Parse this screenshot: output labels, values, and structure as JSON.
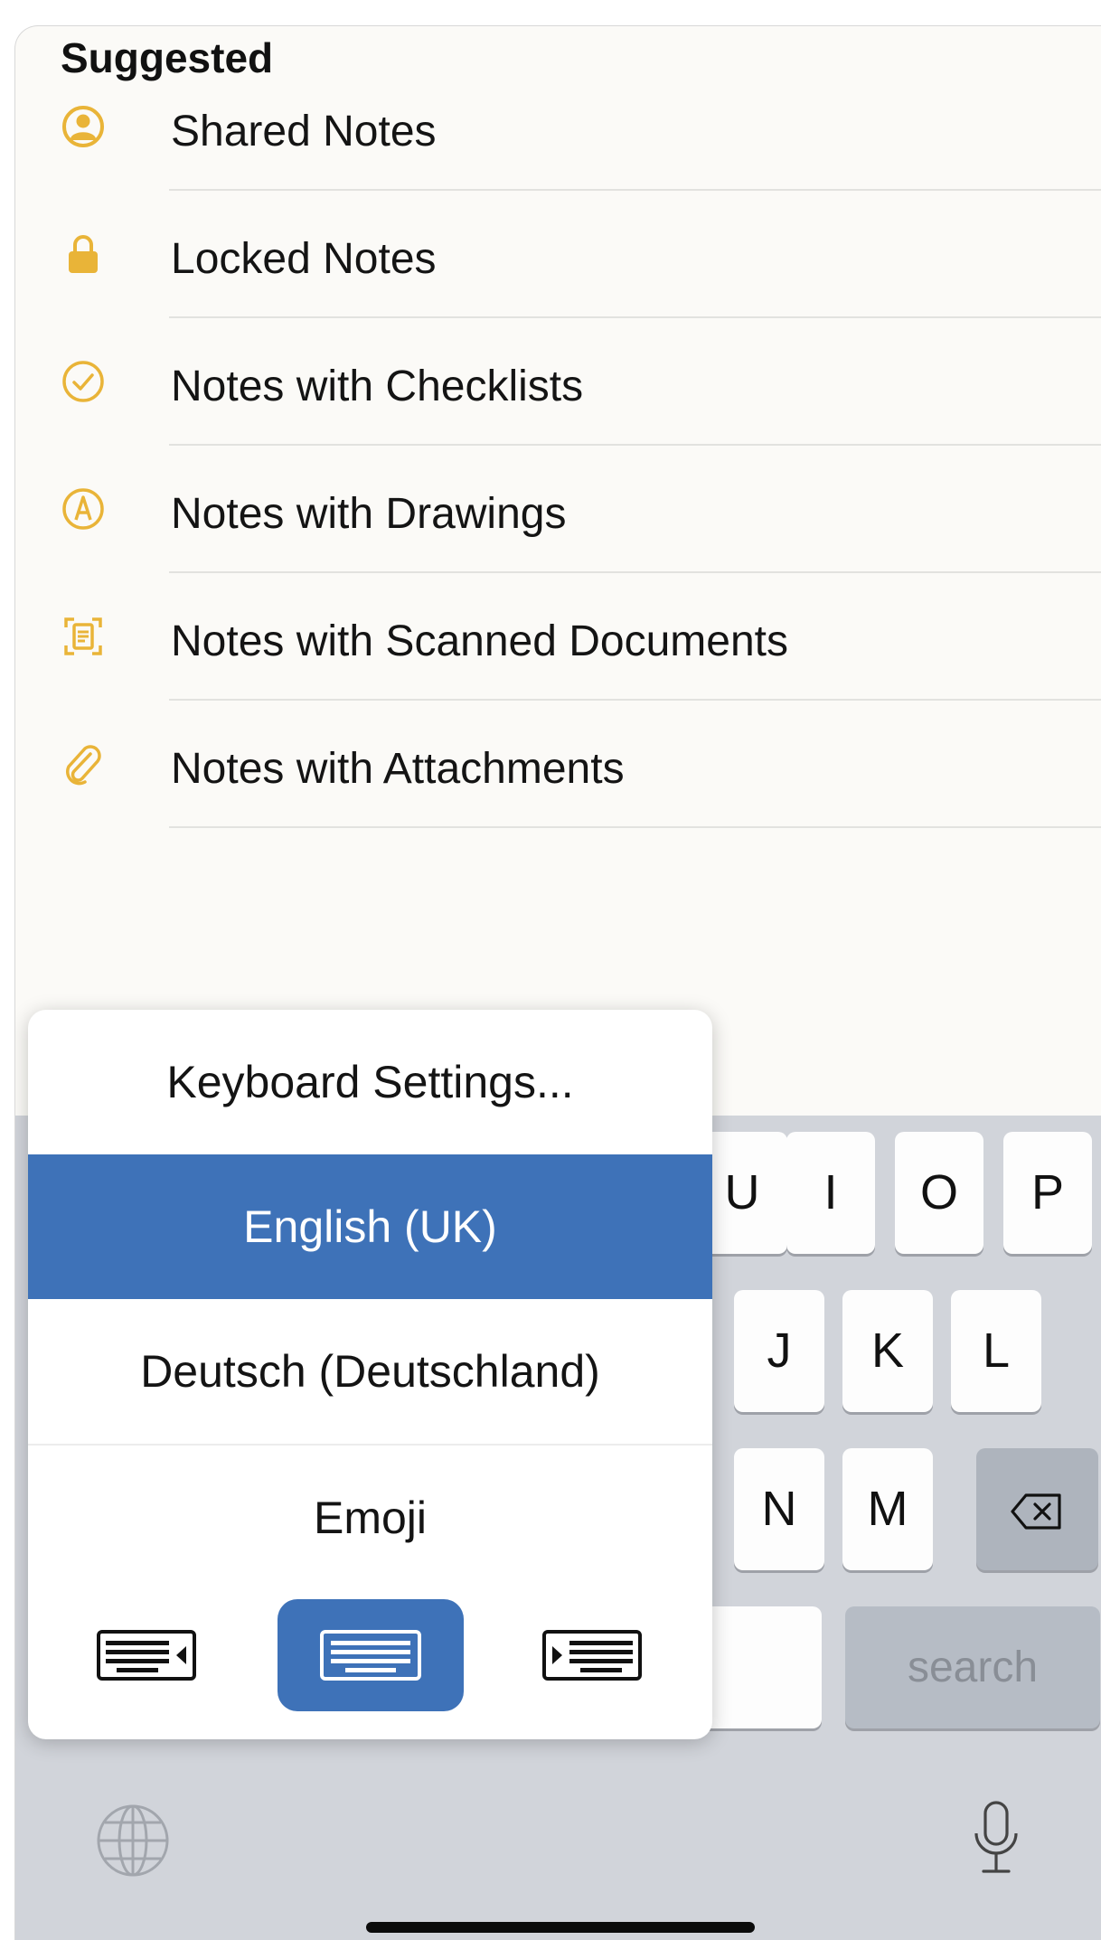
{
  "section": {
    "title": "Suggested"
  },
  "suggested_items": [
    {
      "label": "Shared Notes",
      "icon": "person-circle-icon"
    },
    {
      "label": "Locked Notes",
      "icon": "lock-icon"
    },
    {
      "label": "Notes with Checklists",
      "icon": "checkmark-circle-icon"
    },
    {
      "label": "Notes with Drawings",
      "icon": "pen-circle-icon"
    },
    {
      "label": "Notes with Scanned Documents",
      "icon": "doc-scan-icon"
    },
    {
      "label": "Notes with Attachments",
      "icon": "paperclip-icon"
    }
  ],
  "keyboard_menu": {
    "settings": "Keyboard Settings...",
    "languages": [
      {
        "label": "English (UK)",
        "selected": true
      },
      {
        "label": "Deutsch (Deutschland)",
        "selected": false
      },
      {
        "label": "Emoji",
        "selected": false
      }
    ],
    "modes": [
      "keyboard-left-icon",
      "keyboard-full-icon",
      "keyboard-right-icon"
    ],
    "active_mode": "keyboard-full-icon"
  },
  "keyboard": {
    "row1": [
      "U",
      "I",
      "O",
      "P"
    ],
    "row2": [
      "J",
      "K",
      "L"
    ],
    "row3": [
      "N",
      "M"
    ],
    "search_label": "search"
  },
  "colors": {
    "accent": "#e9b438",
    "selection": "#3e72b8",
    "keyboard_bg": "#d1d4da"
  }
}
